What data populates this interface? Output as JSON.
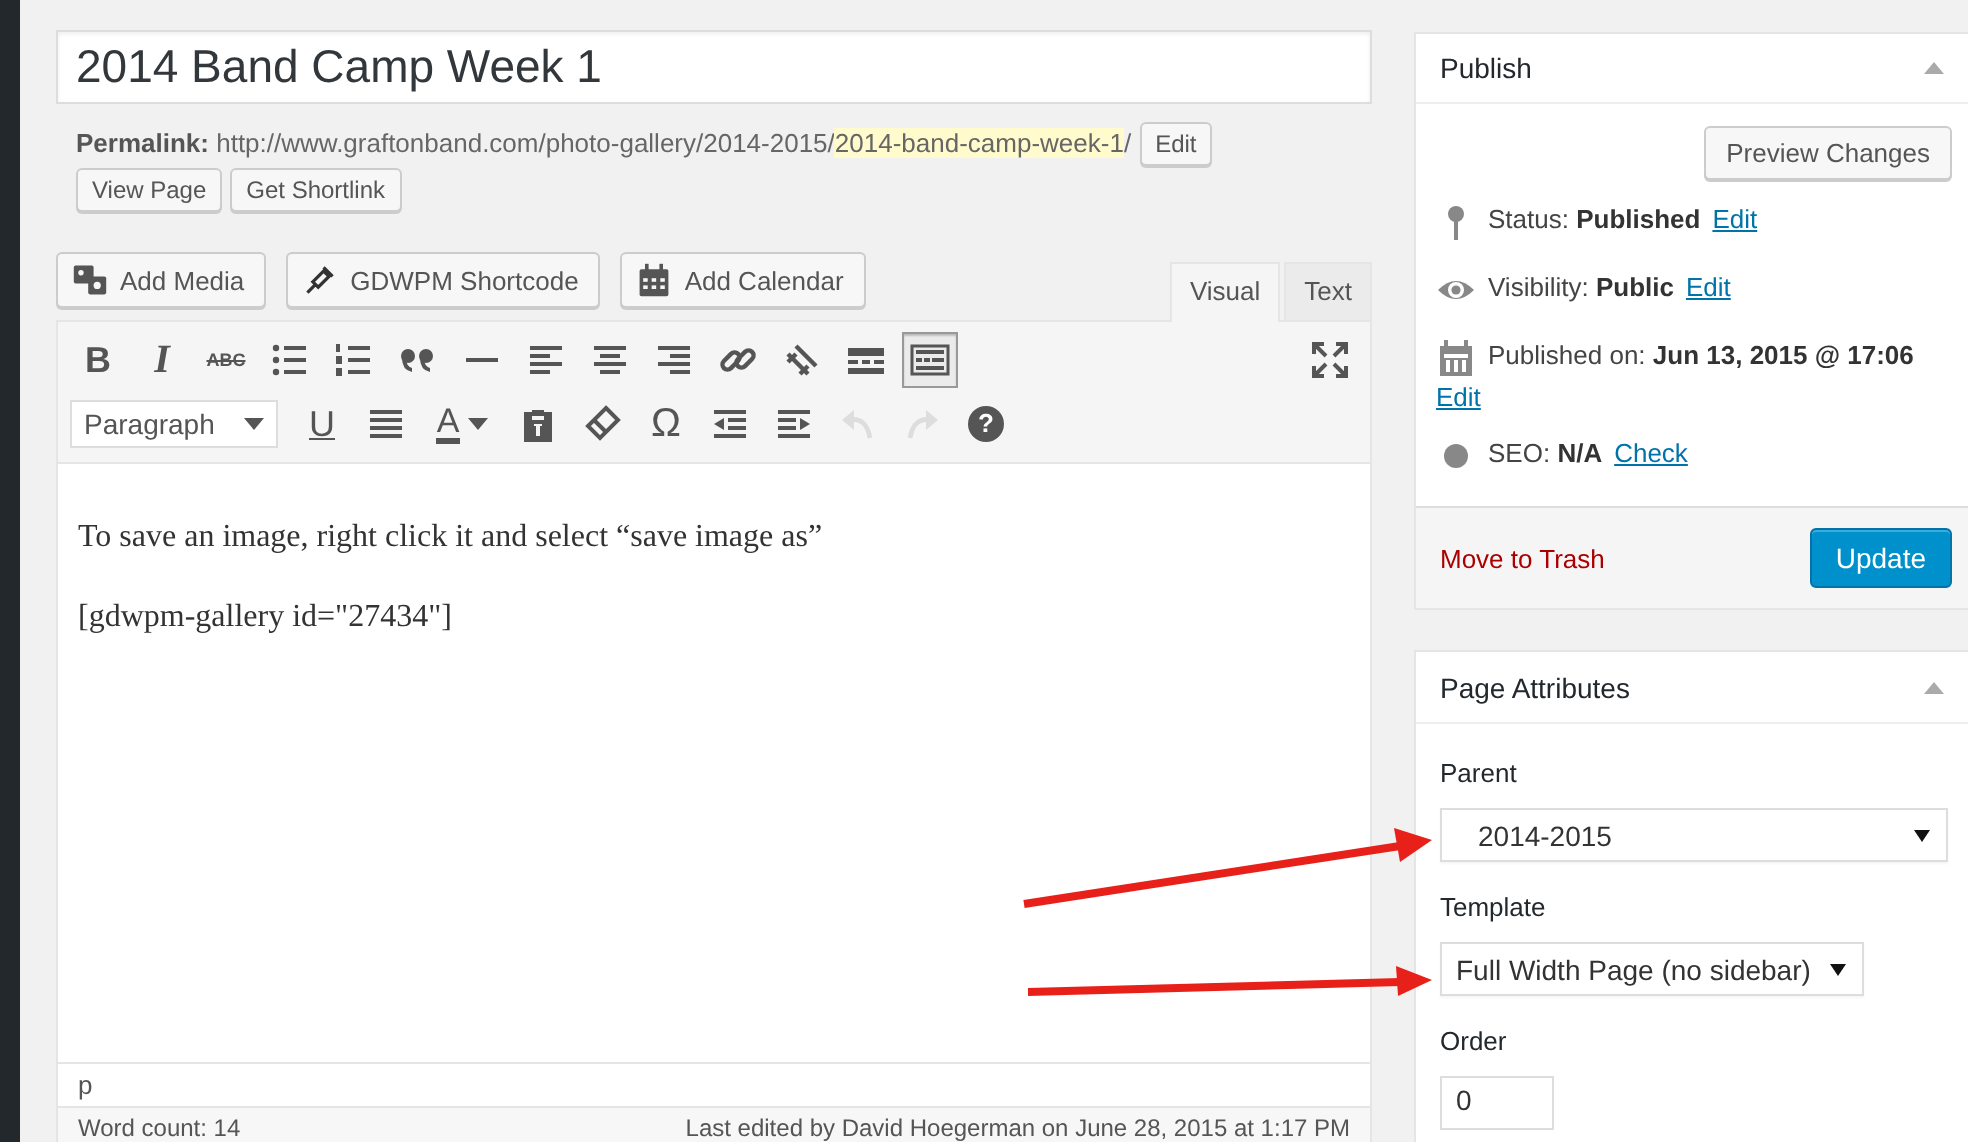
{
  "title": "2014 Band Camp Week 1",
  "permalink": {
    "label": "Permalink:",
    "base": "http://www.graftonband.com/photo-gallery/2014-2015/",
    "slug": "2014-band-camp-week-1",
    "end": "/",
    "edit": "Edit"
  },
  "permalink_buttons": [
    "View Page",
    "Get Shortlink"
  ],
  "media_buttons": [
    {
      "kind": "media",
      "label": "Add Media"
    },
    {
      "kind": "shortcode",
      "label": "GDWPM Shortcode"
    },
    {
      "kind": "calendar",
      "label": "Add Calendar"
    }
  ],
  "editor_tabs": [
    {
      "label": "Visual",
      "selected": true
    },
    {
      "label": "Text",
      "selected": false
    }
  ],
  "toolbar_rows": [
    [
      {
        "kind": "bold",
        "text": "B",
        "pressed": false,
        "disabled": false
      },
      {
        "kind": "italic",
        "text": "I",
        "pressed": false,
        "disabled": false
      },
      {
        "kind": "strike",
        "text": "ABC",
        "pressed": false,
        "disabled": false
      },
      {
        "kind": "bullets",
        "pressed": false,
        "disabled": false
      },
      {
        "kind": "numbers",
        "pressed": false,
        "disabled": false
      },
      {
        "kind": "quote",
        "pressed": false,
        "disabled": false
      },
      {
        "kind": "hr",
        "pressed": false,
        "disabled": false
      },
      {
        "kind": "alignleft",
        "pressed": false,
        "disabled": false
      },
      {
        "kind": "aligncenter",
        "pressed": false,
        "disabled": false
      },
      {
        "kind": "alignright",
        "pressed": false,
        "disabled": false
      },
      {
        "kind": "link",
        "pressed": false,
        "disabled": false
      },
      {
        "kind": "unlink",
        "pressed": false,
        "disabled": false
      },
      {
        "kind": "more",
        "pressed": false,
        "disabled": false
      },
      {
        "kind": "kitchensink",
        "pressed": true,
        "disabled": false
      },
      {
        "kind": "fullscreen",
        "pressed": false,
        "disabled": false
      }
    ],
    [
      {
        "kind": "select",
        "value": "Paragraph",
        "pressed": false,
        "disabled": false
      },
      {
        "kind": "underline",
        "text": "U",
        "pressed": false,
        "disabled": false
      },
      {
        "kind": "justify",
        "pressed": false,
        "disabled": false
      },
      {
        "kind": "color",
        "text": "A",
        "pressed": false,
        "disabled": false
      },
      {
        "kind": "paste",
        "pressed": false,
        "disabled": false
      },
      {
        "kind": "eraser",
        "pressed": false,
        "disabled": false
      },
      {
        "kind": "charmap",
        "text": "Ω",
        "pressed": false,
        "disabled": false
      },
      {
        "kind": "outdent",
        "pressed": false,
        "disabled": false
      },
      {
        "kind": "indent",
        "pressed": false,
        "disabled": false
      },
      {
        "kind": "undo",
        "pressed": false,
        "disabled": true
      },
      {
        "kind": "redo",
        "pressed": false,
        "disabled": true
      },
      {
        "kind": "help",
        "text": "?",
        "pressed": false,
        "disabled": false
      }
    ]
  ],
  "content": [
    "To save an image, right click it and select “save image as”",
    "[gdwpm-gallery id=\"27434\"]"
  ],
  "path": "p",
  "word_count": "Word count: 14",
  "last_edited": "Last edited by David Hoegerman on June 28, 2015 at 1:17 PM",
  "publish": {
    "title": "Publish",
    "preview": "Preview Changes",
    "rows": [
      {
        "kind": "status",
        "label": "Status:",
        "value": "Published",
        "link": "Edit"
      },
      {
        "kind": "visibility",
        "label": "Visibility:",
        "value": "Public",
        "link": "Edit"
      },
      {
        "kind": "date",
        "label": "Published on:",
        "value": "Jun 13, 2015 @ 17:06",
        "link": "Edit"
      },
      {
        "kind": "seo",
        "label": "SEO:",
        "value": "N/A",
        "link": "Check"
      }
    ],
    "trash": "Move to Trash",
    "update": "Update"
  },
  "page_attributes": {
    "title": "Page Attributes",
    "fields": [
      {
        "kind": "select",
        "label": "Parent",
        "value": "2014-2015"
      },
      {
        "kind": "select",
        "label": "Template",
        "value": "Full Width Page (no sidebar)"
      },
      {
        "kind": "input",
        "label": "Order",
        "value": "0"
      }
    ]
  }
}
